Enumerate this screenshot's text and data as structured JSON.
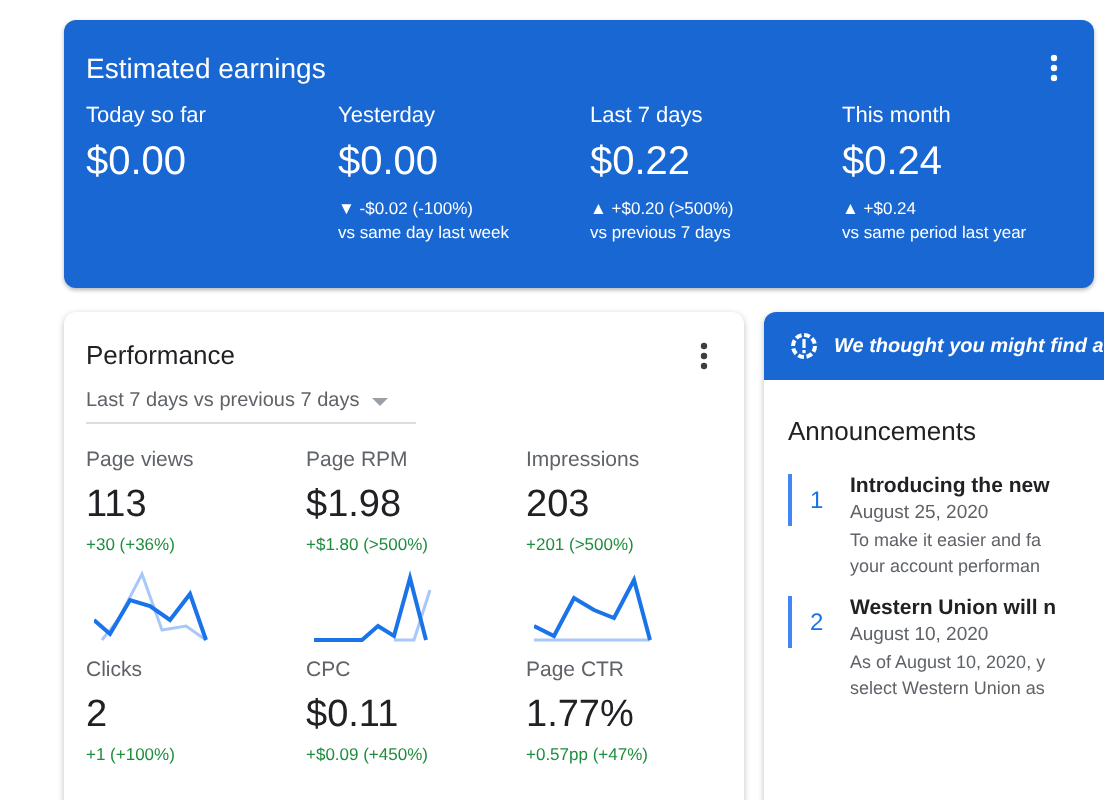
{
  "earnings": {
    "title": "Estimated earnings",
    "stats": [
      {
        "label": "Today so far",
        "value": "$0.00"
      },
      {
        "label": "Yesterday",
        "value": "$0.00",
        "change": "▼ -$0.02 (-100%)",
        "comparison": "vs same day last week"
      },
      {
        "label": "Last 7 days",
        "value": "$0.22",
        "change": "▲ +$0.20 (>500%)",
        "comparison": "vs previous 7 days"
      },
      {
        "label": "This month",
        "value": "$0.24",
        "change": "▲ +$0.24",
        "comparison": "vs same period last year"
      }
    ]
  },
  "performance": {
    "title": "Performance",
    "period": "Last 7 days vs previous 7 days",
    "metrics": [
      {
        "label": "Page views",
        "value": "113",
        "change": "+30 (+36%)"
      },
      {
        "label": "Page RPM",
        "value": "$1.98",
        "change": "+$1.80 (>500%)"
      },
      {
        "label": "Impressions",
        "value": "203",
        "change": "+201 (>500%)"
      },
      {
        "label": "Clicks",
        "value": "2",
        "change": "+1 (+100%)"
      },
      {
        "label": "CPC",
        "value": "$0.11",
        "change": "+$0.09 (+450%)"
      },
      {
        "label": "Page CTR",
        "value": "1.77%",
        "change": "+0.57pp (+47%)"
      }
    ]
  },
  "tip_banner": {
    "text": "We thought you might find a"
  },
  "announcements": {
    "title": "Announcements",
    "items": [
      {
        "number": "1",
        "title": "Introducing the new",
        "date": "August 25, 2020",
        "lines": [
          "To make it easier and fa",
          "your account performan"
        ]
      },
      {
        "number": "2",
        "title": "Western Union will n",
        "date": "August 10, 2020",
        "lines": [
          "As of August 10, 2020, y",
          "select Western Union as"
        ]
      }
    ]
  }
}
